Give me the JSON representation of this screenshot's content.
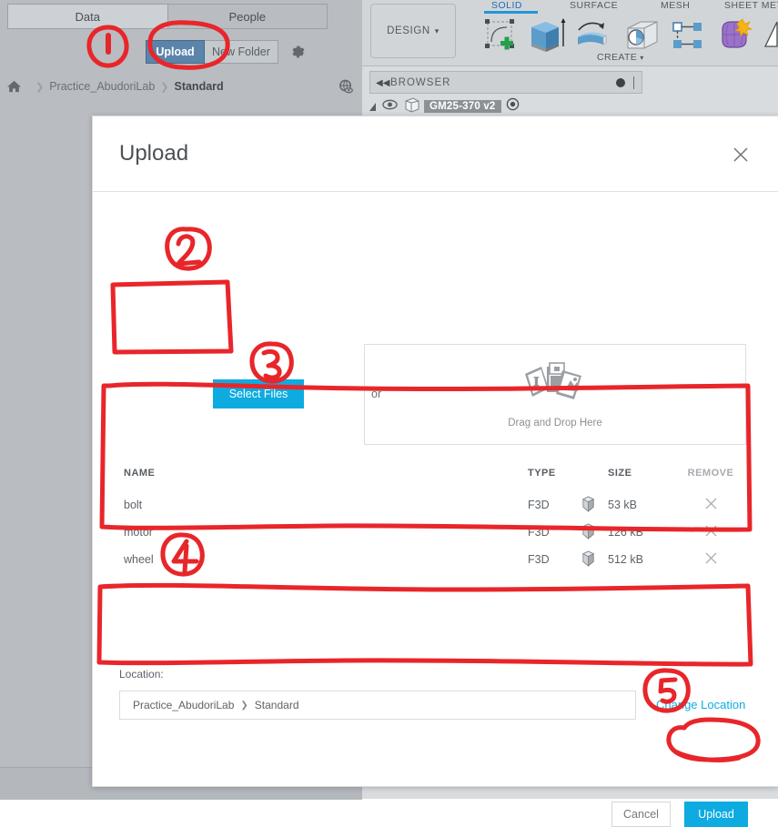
{
  "data_panel": {
    "tabs": [
      {
        "label": "Data",
        "active": true
      },
      {
        "label": "People",
        "active": false
      }
    ],
    "actions": {
      "upload_label": "Upload",
      "new_folder_label": "New Folder",
      "gear_icon": "gear-icon",
      "globe_icon": "globe-eye-icon"
    },
    "breadcrumb": {
      "home_icon": "home-icon",
      "separator": "❯",
      "items": [
        "Practice_AbudoriLab",
        "Standard"
      ]
    }
  },
  "fusion": {
    "design_menu": "DESIGN",
    "design_caret": "▾",
    "ribbon_tabs": [
      {
        "label": "SOLID",
        "active": true
      },
      {
        "label": "SURFACE",
        "active": false
      },
      {
        "label": "MESH",
        "active": false
      },
      {
        "label": "SHEET METAL",
        "active": false
      }
    ],
    "create_label": "CREATE",
    "create_caret": "▾",
    "tool_icons": [
      "create-sketch-icon",
      "extrude-icon",
      "revolve-icon",
      "sweep-icon",
      "pattern-icon",
      "form-icon",
      "mirror-icon"
    ],
    "browser": {
      "title": "BROWSER",
      "collapse_icon": "double-left-arrow-icon",
      "dot_icon": "minus-circle-icon",
      "node_label": "GM25-370 v2",
      "eye_icon": "eye-icon",
      "cube_icon": "component-cube-icon",
      "target_icon": "target-dot-icon",
      "expand_icon": "expand-triangle-icon"
    }
  },
  "dialog": {
    "title": "Upload",
    "close_icon": "close-icon",
    "select_files_label": "Select Files",
    "or_label": "or",
    "dropzone": {
      "label": "Drag and Drop Here",
      "icon": "documents-stack-icon"
    },
    "file_table": {
      "columns": [
        "NAME",
        "TYPE",
        "SIZE",
        "REMOVE"
      ],
      "rows": [
        {
          "name": "bolt",
          "type": "F3D",
          "icon": "f3d-cube-icon",
          "size": "53 kB",
          "remove_icon": "close-icon"
        },
        {
          "name": "motor",
          "type": "F3D",
          "icon": "f3d-cube-icon",
          "size": "126 kB",
          "remove_icon": "close-icon"
        },
        {
          "name": "wheel",
          "type": "F3D",
          "icon": "f3d-cube-icon",
          "size": "512 kB",
          "remove_icon": "close-icon"
        }
      ]
    },
    "location": {
      "label": "Location:",
      "value_root": "Practice_AbudoriLab",
      "separator": "❯",
      "value_leaf": "Standard",
      "change_link": "Change Location"
    },
    "footer": {
      "cancel_label": "Cancel",
      "upload_label": "Upload"
    }
  },
  "annotations": {
    "color": "#e8262a",
    "markers": [
      {
        "id": "1",
        "text": "1"
      },
      {
        "id": "2",
        "text": "2"
      },
      {
        "id": "3",
        "text": "3"
      },
      {
        "id": "4",
        "text": "4"
      },
      {
        "id": "5",
        "text": "5"
      }
    ]
  },
  "colors": {
    "accent_blue": "#0eabe0",
    "top_upload_blue": "#5b84ab",
    "annotation_red": "#e8262a",
    "panel_gray": "#b9bdc2",
    "toolbar_gray": "#d2d5d8"
  }
}
